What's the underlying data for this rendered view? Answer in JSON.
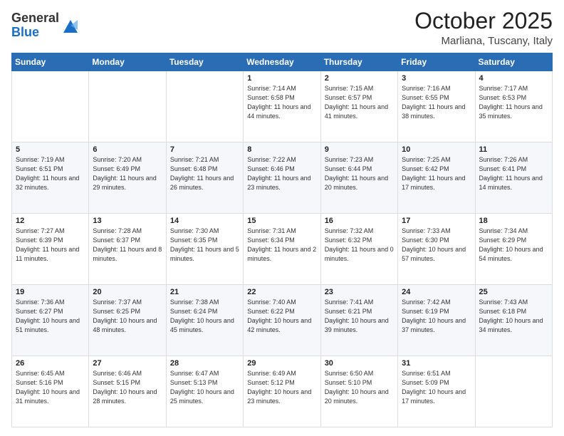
{
  "logo": {
    "general": "General",
    "blue": "Blue"
  },
  "header": {
    "month": "October 2025",
    "location": "Marliana, Tuscany, Italy"
  },
  "weekdays": [
    "Sunday",
    "Monday",
    "Tuesday",
    "Wednesday",
    "Thursday",
    "Friday",
    "Saturday"
  ],
  "weeks": [
    [
      {
        "day": "",
        "info": ""
      },
      {
        "day": "",
        "info": ""
      },
      {
        "day": "",
        "info": ""
      },
      {
        "day": "1",
        "info": "Sunrise: 7:14 AM\nSunset: 6:58 PM\nDaylight: 11 hours\nand 44 minutes."
      },
      {
        "day": "2",
        "info": "Sunrise: 7:15 AM\nSunset: 6:57 PM\nDaylight: 11 hours\nand 41 minutes."
      },
      {
        "day": "3",
        "info": "Sunrise: 7:16 AM\nSunset: 6:55 PM\nDaylight: 11 hours\nand 38 minutes."
      },
      {
        "day": "4",
        "info": "Sunrise: 7:17 AM\nSunset: 6:53 PM\nDaylight: 11 hours\nand 35 minutes."
      }
    ],
    [
      {
        "day": "5",
        "info": "Sunrise: 7:19 AM\nSunset: 6:51 PM\nDaylight: 11 hours\nand 32 minutes."
      },
      {
        "day": "6",
        "info": "Sunrise: 7:20 AM\nSunset: 6:49 PM\nDaylight: 11 hours\nand 29 minutes."
      },
      {
        "day": "7",
        "info": "Sunrise: 7:21 AM\nSunset: 6:48 PM\nDaylight: 11 hours\nand 26 minutes."
      },
      {
        "day": "8",
        "info": "Sunrise: 7:22 AM\nSunset: 6:46 PM\nDaylight: 11 hours\nand 23 minutes."
      },
      {
        "day": "9",
        "info": "Sunrise: 7:23 AM\nSunset: 6:44 PM\nDaylight: 11 hours\nand 20 minutes."
      },
      {
        "day": "10",
        "info": "Sunrise: 7:25 AM\nSunset: 6:42 PM\nDaylight: 11 hours\nand 17 minutes."
      },
      {
        "day": "11",
        "info": "Sunrise: 7:26 AM\nSunset: 6:41 PM\nDaylight: 11 hours\nand 14 minutes."
      }
    ],
    [
      {
        "day": "12",
        "info": "Sunrise: 7:27 AM\nSunset: 6:39 PM\nDaylight: 11 hours\nand 11 minutes."
      },
      {
        "day": "13",
        "info": "Sunrise: 7:28 AM\nSunset: 6:37 PM\nDaylight: 11 hours\nand 8 minutes."
      },
      {
        "day": "14",
        "info": "Sunrise: 7:30 AM\nSunset: 6:35 PM\nDaylight: 11 hours\nand 5 minutes."
      },
      {
        "day": "15",
        "info": "Sunrise: 7:31 AM\nSunset: 6:34 PM\nDaylight: 11 hours\nand 2 minutes."
      },
      {
        "day": "16",
        "info": "Sunrise: 7:32 AM\nSunset: 6:32 PM\nDaylight: 11 hours\nand 0 minutes."
      },
      {
        "day": "17",
        "info": "Sunrise: 7:33 AM\nSunset: 6:30 PM\nDaylight: 10 hours\nand 57 minutes."
      },
      {
        "day": "18",
        "info": "Sunrise: 7:34 AM\nSunset: 6:29 PM\nDaylight: 10 hours\nand 54 minutes."
      }
    ],
    [
      {
        "day": "19",
        "info": "Sunrise: 7:36 AM\nSunset: 6:27 PM\nDaylight: 10 hours\nand 51 minutes."
      },
      {
        "day": "20",
        "info": "Sunrise: 7:37 AM\nSunset: 6:25 PM\nDaylight: 10 hours\nand 48 minutes."
      },
      {
        "day": "21",
        "info": "Sunrise: 7:38 AM\nSunset: 6:24 PM\nDaylight: 10 hours\nand 45 minutes."
      },
      {
        "day": "22",
        "info": "Sunrise: 7:40 AM\nSunset: 6:22 PM\nDaylight: 10 hours\nand 42 minutes."
      },
      {
        "day": "23",
        "info": "Sunrise: 7:41 AM\nSunset: 6:21 PM\nDaylight: 10 hours\nand 39 minutes."
      },
      {
        "day": "24",
        "info": "Sunrise: 7:42 AM\nSunset: 6:19 PM\nDaylight: 10 hours\nand 37 minutes."
      },
      {
        "day": "25",
        "info": "Sunrise: 7:43 AM\nSunset: 6:18 PM\nDaylight: 10 hours\nand 34 minutes."
      }
    ],
    [
      {
        "day": "26",
        "info": "Sunrise: 6:45 AM\nSunset: 5:16 PM\nDaylight: 10 hours\nand 31 minutes."
      },
      {
        "day": "27",
        "info": "Sunrise: 6:46 AM\nSunset: 5:15 PM\nDaylight: 10 hours\nand 28 minutes."
      },
      {
        "day": "28",
        "info": "Sunrise: 6:47 AM\nSunset: 5:13 PM\nDaylight: 10 hours\nand 25 minutes."
      },
      {
        "day": "29",
        "info": "Sunrise: 6:49 AM\nSunset: 5:12 PM\nDaylight: 10 hours\nand 23 minutes."
      },
      {
        "day": "30",
        "info": "Sunrise: 6:50 AM\nSunset: 5:10 PM\nDaylight: 10 hours\nand 20 minutes."
      },
      {
        "day": "31",
        "info": "Sunrise: 6:51 AM\nSunset: 5:09 PM\nDaylight: 10 hours\nand 17 minutes."
      },
      {
        "day": "",
        "info": ""
      }
    ]
  ]
}
